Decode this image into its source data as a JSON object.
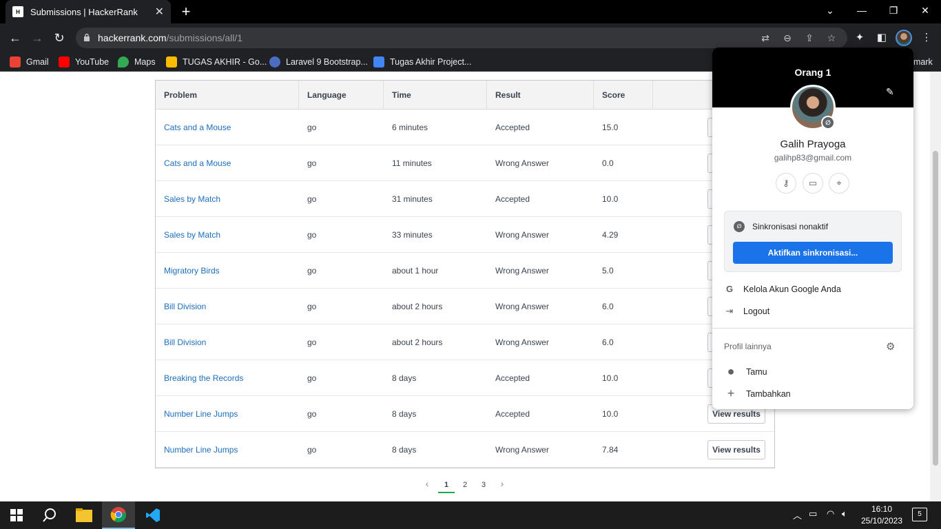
{
  "browser": {
    "tab_title": "Submissions | HackerRank",
    "tab_close": "✕",
    "new_tab": "+",
    "window_controls": [
      "⌄",
      "—",
      "❐",
      "✕"
    ],
    "url_host": "hackerrank.com",
    "url_path": "/submissions/all/1",
    "icons": [
      "translate-icon",
      "zoom-icon",
      "share-icon",
      "star-icon",
      "extensions-icon",
      "sidepanel-icon",
      "more-icon"
    ]
  },
  "bookmarks": [
    {
      "label": "Gmail",
      "color": "#ea4335"
    },
    {
      "label": "YouTube",
      "color": "#ff0000"
    },
    {
      "label": "Maps",
      "color": "#34a853"
    },
    {
      "label": "TUGAS AKHIR - Go...",
      "color": "#fbbc04"
    },
    {
      "label": "Laravel 9 Bootstrap...",
      "color": "#4b6cc1"
    },
    {
      "label": "Tugas Akhir Project...",
      "color": "#4285f4"
    }
  ],
  "bookmark_overflow": "mark",
  "table": {
    "headers": [
      "Problem",
      "Language",
      "Time",
      "Result",
      "Score"
    ],
    "view_label": "View results",
    "rows": [
      {
        "problem": "Cats and a Mouse",
        "language": "go",
        "time": "6 minutes",
        "result": "Accepted",
        "score": "15.0"
      },
      {
        "problem": "Cats and a Mouse",
        "language": "go",
        "time": "11 minutes",
        "result": "Wrong Answer",
        "score": "0.0"
      },
      {
        "problem": "Sales by Match",
        "language": "go",
        "time": "31 minutes",
        "result": "Accepted",
        "score": "10.0"
      },
      {
        "problem": "Sales by Match",
        "language": "go",
        "time": "33 minutes",
        "result": "Wrong Answer",
        "score": "4.29"
      },
      {
        "problem": "Migratory Birds",
        "language": "go",
        "time": "about 1 hour",
        "result": "Wrong Answer",
        "score": "5.0"
      },
      {
        "problem": "Bill Division",
        "language": "go",
        "time": "about 2 hours",
        "result": "Wrong Answer",
        "score": "6.0"
      },
      {
        "problem": "Bill Division",
        "language": "go",
        "time": "about 2 hours",
        "result": "Wrong Answer",
        "score": "6.0"
      },
      {
        "problem": "Breaking the Records",
        "language": "go",
        "time": "8 days",
        "result": "Accepted",
        "score": "10.0"
      },
      {
        "problem": "Number Line Jumps",
        "language": "go",
        "time": "8 days",
        "result": "Accepted",
        "score": "10.0"
      },
      {
        "problem": "Number Line Jumps",
        "language": "go",
        "time": "8 days",
        "result": "Wrong Answer",
        "score": "7.84"
      }
    ]
  },
  "pagination": {
    "prev": "‹",
    "pages": [
      "1",
      "2",
      "3"
    ],
    "current": "1",
    "next": "›"
  },
  "profile_popup": {
    "profile_name": "Orang 1",
    "user_name": "Galih Prayoga",
    "email": "galihp83@gmail.com",
    "sync_status": "Sinkronisasi nonaktif",
    "sync_button": "Aktifkan sinkronisasi...",
    "manage_account": "Kelola Akun Google Anda",
    "logout": "Logout",
    "other_profiles": "Profil lainnya",
    "guest": "Tamu",
    "add": "Tambahkan"
  },
  "taskbar": {
    "time": "16:10",
    "date": "25/10/2023",
    "notifications": "5"
  }
}
